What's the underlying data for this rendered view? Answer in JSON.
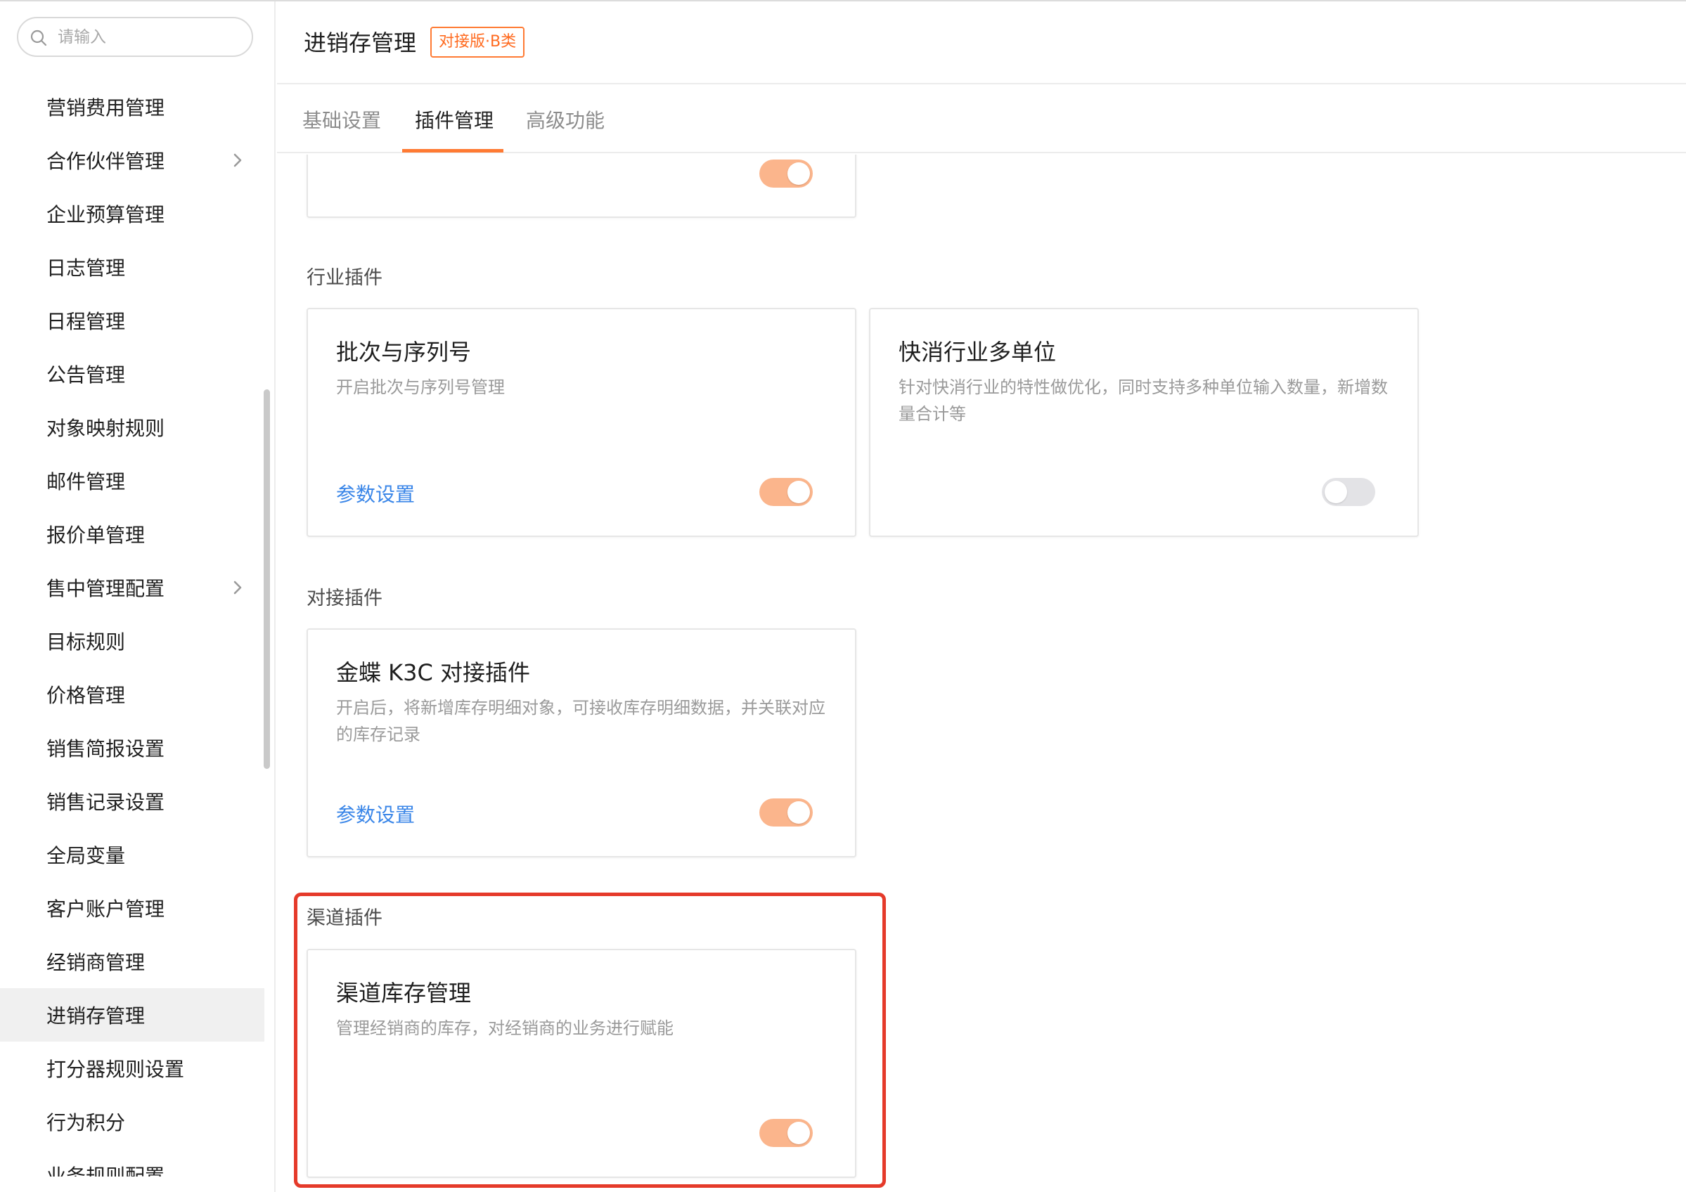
{
  "search": {
    "placeholder": "请输入"
  },
  "sidebar": {
    "items": [
      {
        "label": "营销费用管理",
        "has_children": false
      },
      {
        "label": "合作伙伴管理",
        "has_children": true
      },
      {
        "label": "企业预算管理",
        "has_children": false
      },
      {
        "label": "日志管理",
        "has_children": false
      },
      {
        "label": "日程管理",
        "has_children": false
      },
      {
        "label": "公告管理",
        "has_children": false
      },
      {
        "label": "对象映射规则",
        "has_children": false
      },
      {
        "label": "邮件管理",
        "has_children": false
      },
      {
        "label": "报价单管理",
        "has_children": false
      },
      {
        "label": "售中管理配置",
        "has_children": true
      },
      {
        "label": "目标规则",
        "has_children": false
      },
      {
        "label": "价格管理",
        "has_children": false
      },
      {
        "label": "销售简报设置",
        "has_children": false
      },
      {
        "label": "销售记录设置",
        "has_children": false
      },
      {
        "label": "全局变量",
        "has_children": false
      },
      {
        "label": "客户账户管理",
        "has_children": false
      },
      {
        "label": "经销商管理",
        "has_children": false
      },
      {
        "label": "进销存管理",
        "has_children": false,
        "active": true
      },
      {
        "label": "打分器规则设置",
        "has_children": false
      },
      {
        "label": "行为积分",
        "has_children": false
      },
      {
        "label": "业务规则配置",
        "has_children": false
      }
    ]
  },
  "header": {
    "title": "进销存管理",
    "badge": "对接版·B类"
  },
  "tabs": [
    {
      "label": "基础设置",
      "active": false
    },
    {
      "label": "插件管理",
      "active": true
    },
    {
      "label": "高级功能",
      "active": false
    }
  ],
  "sections": {
    "top_card": {
      "toggle_on": true
    },
    "industry": {
      "title": "行业插件",
      "cards": [
        {
          "title": "批次与序列号",
          "desc": "开启批次与序列号管理",
          "link": "参数设置",
          "toggle_on": true
        },
        {
          "title": "快消行业多单位",
          "desc": "针对快消行业的特性做优化，同时支持多种单位输入数量，新增数量合计等",
          "toggle_on": false
        }
      ]
    },
    "integration": {
      "title": "对接插件",
      "cards": [
        {
          "title": "金蝶 K3C 对接插件",
          "desc": "开启后，将新增库存明细对象，可接收库存明细数据，并关联对应的库存记录",
          "link": "参数设置",
          "toggle_on": true
        }
      ]
    },
    "channel": {
      "title": "渠道插件",
      "cards": [
        {
          "title": "渠道库存管理",
          "desc": "管理经销商的库存，对经销商的业务进行赋能",
          "toggle_on": true
        }
      ]
    }
  },
  "colors": {
    "accent": "#ff7a33",
    "toggle_on": "#fbb58c",
    "link": "#3a86e8",
    "highlight": "#e53a2a"
  }
}
